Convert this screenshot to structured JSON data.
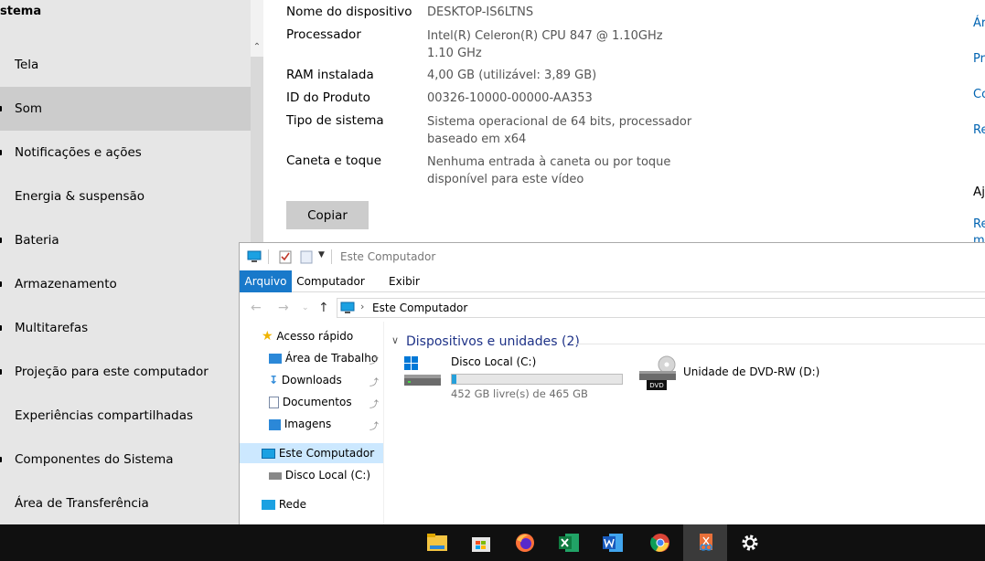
{
  "sidebar": {
    "section": "stema",
    "items": [
      {
        "label": "Tela"
      },
      {
        "label": "Som"
      },
      {
        "label": "Notificações e ações"
      },
      {
        "label": "Energia & suspensão"
      },
      {
        "label": "Bateria"
      },
      {
        "label": "Armazenamento"
      },
      {
        "label": "Multitarefas"
      },
      {
        "label": "Projeção para este computador"
      },
      {
        "label": "Experiências compartilhadas"
      },
      {
        "label": "Componentes do Sistema"
      },
      {
        "label": "Área de Transferência"
      }
    ],
    "active_index": 1
  },
  "specs": {
    "device_name_label": "Nome do dispositivo",
    "device_name_value": "DESKTOP-IS6LTNS",
    "processor_label": "Processador",
    "processor_value": "Intel(R) Celeron(R) CPU 847 @ 1.10GHz   1.10 GHz",
    "ram_label": "RAM instalada",
    "ram_value": "4,00 GB (utilizável: 3,89 GB)",
    "product_id_label": "ID do Produto",
    "product_id_value": "00326-10000-00000-AA353",
    "system_type_label": "Tipo de sistema",
    "system_type_value": "Sistema operacional de 64 bits, processador baseado em x64",
    "pen_label": "Caneta e toque",
    "pen_value": "Nenhuma entrada à caneta ou por toque disponível para este vídeo",
    "copy_button": "Copiar"
  },
  "right_panel": {
    "links": [
      "Ár",
      "Pr",
      "Co",
      "Re"
    ],
    "help_heading": "Aj",
    "help_link_1": "Re",
    "help_link_2": "m"
  },
  "explorer": {
    "title": "Este Computador",
    "tabs": {
      "file": "Arquivo",
      "computer": "Computador",
      "view": "Exibir"
    },
    "address": "Este Computador",
    "nav": {
      "quick_access": "Acesso rápido",
      "desktop": "Área de Trabalho",
      "downloads": "Downloads",
      "documents": "Documentos",
      "images": "Imagens",
      "this_pc": "Este Computador",
      "local_disk": "Disco Local (C:)",
      "network": "Rede"
    },
    "group_title": "Dispositivos e unidades (2)",
    "drives": {
      "c_name": "Disco Local (C:)",
      "c_free": "452 GB livre(s) de 465 GB",
      "c_used_fraction": 0.028,
      "d_name": "Unidade de DVD-RW (D:)",
      "d_badge": "DVD"
    }
  },
  "taskbar": {
    "apps": [
      "file-explorer-icon",
      "store-icon",
      "firefox-icon",
      "excel-icon",
      "word-icon",
      "chrome-icon",
      "snip-icon",
      "settings-icon"
    ],
    "active_index": 6
  },
  "colors": {
    "accent": "#1979ca",
    "link": "#0063b1",
    "group_title": "#1e3287",
    "bar_fill": "#26a0da"
  }
}
